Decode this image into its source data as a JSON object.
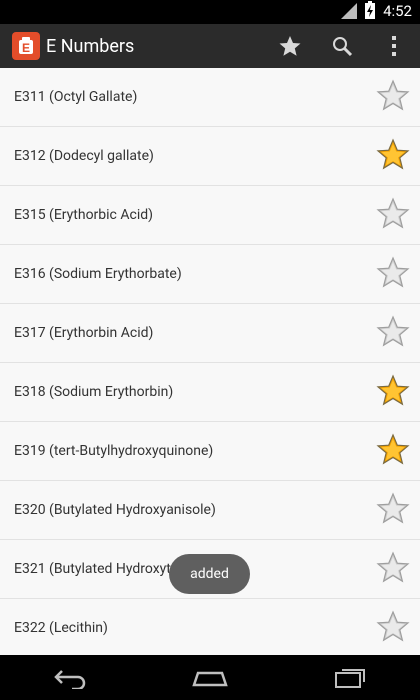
{
  "status": {
    "time": "4:52"
  },
  "app": {
    "title": "E Numbers"
  },
  "toolbar": {
    "icons": [
      "star-icon",
      "search-icon",
      "overflow-menu-icon"
    ]
  },
  "list": [
    {
      "label": "E311 (Octyl Gallate)",
      "favorite": false
    },
    {
      "label": "E312 (Dodecyl gallate)",
      "favorite": true
    },
    {
      "label": "E315 (Erythorbic Acid)",
      "favorite": false
    },
    {
      "label": "E316 (Sodium Erythorbate)",
      "favorite": false
    },
    {
      "label": "E317 (Erythorbin Acid)",
      "favorite": false
    },
    {
      "label": "E318 (Sodium Erythorbin)",
      "favorite": true
    },
    {
      "label": "E319 (tert-Butylhydroxyquinone)",
      "favorite": true
    },
    {
      "label": "E320 (Butylated Hydroxyanisole)",
      "favorite": false
    },
    {
      "label": "E321 (Butylated Hydroxytoluene)",
      "favorite": false
    },
    {
      "label": "E322 (Lecithin)",
      "favorite": false
    }
  ],
  "toast": {
    "text": "added"
  },
  "colors": {
    "accent": "#e34d2a",
    "star_on": "#f5a300",
    "star_off": "#bdbdbd"
  }
}
